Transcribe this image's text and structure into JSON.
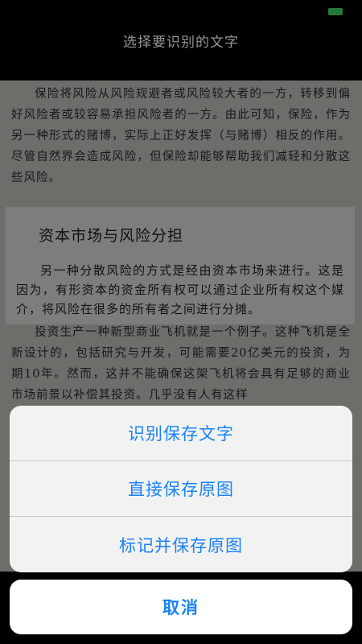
{
  "header": {
    "title": "选择要识别的文字"
  },
  "status": {
    "battery_color": "#3fd25a"
  },
  "document": {
    "top_paragraph": "保险将风险从风险规避者或风险较大者的一方，转移到偏好风险者或较容易承担风险者的一方。由此可知，保险，作为另一种形式的赌博，实际上正好发挥（与赌博）相反的作用。尽管自然界会造成风险，但保险却能够帮助我们减轻和分散这些风险。",
    "selected_heading": "资本市场与风险分担",
    "selected_paragraph": "另一种分散风险的方式是经由资本市场来进行。这是因为，有形资本的资金所有权可以通过企业所有权这个媒介，将风险在很多的所有者之间进行分摊。",
    "bottom_paragraph": "投资生产一种新型商业飞机就是一个例子。这种飞机是全新设计的，包括研究与开发，可能需要20亿美元的投资，为期10年。然而，这并不能确保这架飞机将会具有足够的商业市场前景以补偿其投资。几乎没有人有这样"
  },
  "action_sheet": {
    "recognize_save_text": "识别保存文字",
    "save_original": "直接保存原图",
    "mark_save_original": "标记并保存原图",
    "cancel": "取消"
  },
  "colors": {
    "accent": "#1a82f7"
  }
}
